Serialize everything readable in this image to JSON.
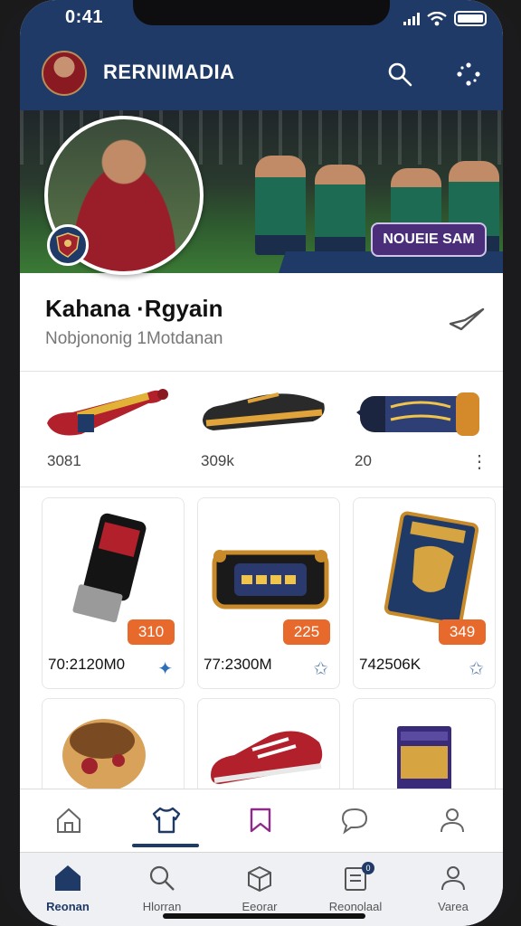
{
  "status": {
    "time": "0:41"
  },
  "appbar": {
    "title": "RERNIMADIA",
    "avatar_icon": "player-avatar-icon",
    "search_icon": "search-icon",
    "more_icon": "dots-icon"
  },
  "banner": {
    "button_label": "NOUEIE SAM"
  },
  "profile": {
    "name": "Kahana ·Rgyain",
    "subtitle": "Nobjononig 1Motdanan"
  },
  "strip": {
    "items": [
      {
        "value": "3081"
      },
      {
        "value": "309k"
      },
      {
        "value": "20"
      }
    ]
  },
  "cards": [
    {
      "price": "310",
      "label": "70:2120M0",
      "icon": "star-icon"
    },
    {
      "price": "225",
      "label": "77:2300M",
      "icon": "star-icon"
    },
    {
      "price": "349",
      "label": "742506K",
      "icon": "star-icon"
    }
  ],
  "tabbar": {
    "tabs": [
      "home-icon",
      "jersey-icon",
      "bookmark-icon",
      "chat-icon",
      "user-icon"
    ]
  },
  "nav": {
    "items": [
      {
        "label": "Reonan",
        "icon": "home-icon"
      },
      {
        "label": "Hlorran",
        "icon": "search-icon"
      },
      {
        "label": "Eeorar",
        "icon": "box-icon"
      },
      {
        "label": "Reonolaal",
        "icon": "inbox-icon",
        "badge": "0"
      },
      {
        "label": "Varea",
        "icon": "user-icon"
      }
    ]
  },
  "colors": {
    "brand": "#1f3a66",
    "accent": "#e8692c",
    "badge": "#4a2e7a"
  }
}
